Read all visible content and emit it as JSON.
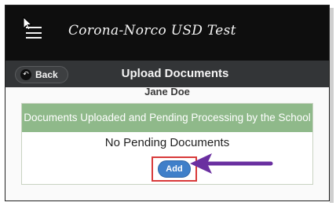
{
  "app": {
    "title": "Corona-Norco USD Test"
  },
  "subheader": {
    "back_label": "Back",
    "page_title": "Upload Documents"
  },
  "content": {
    "student_name": "Jane Doe",
    "panel_header": "Documents Uploaded and Pending Processing by the School",
    "pending_text": "No Pending Documents",
    "add_label": "Add"
  },
  "icons": {
    "menu": "hamburger-icon",
    "back": "back-arrow-icon",
    "cursor": "cursor-icon",
    "annotation": "arrow-icon"
  },
  "colors": {
    "topbar": "#0e0e0e",
    "subheader": "#333537",
    "panel_header": "#8fb98a",
    "add_button": "#3f7fc9",
    "highlight": "#d83a3a",
    "arrow": "#6a2fa0"
  }
}
